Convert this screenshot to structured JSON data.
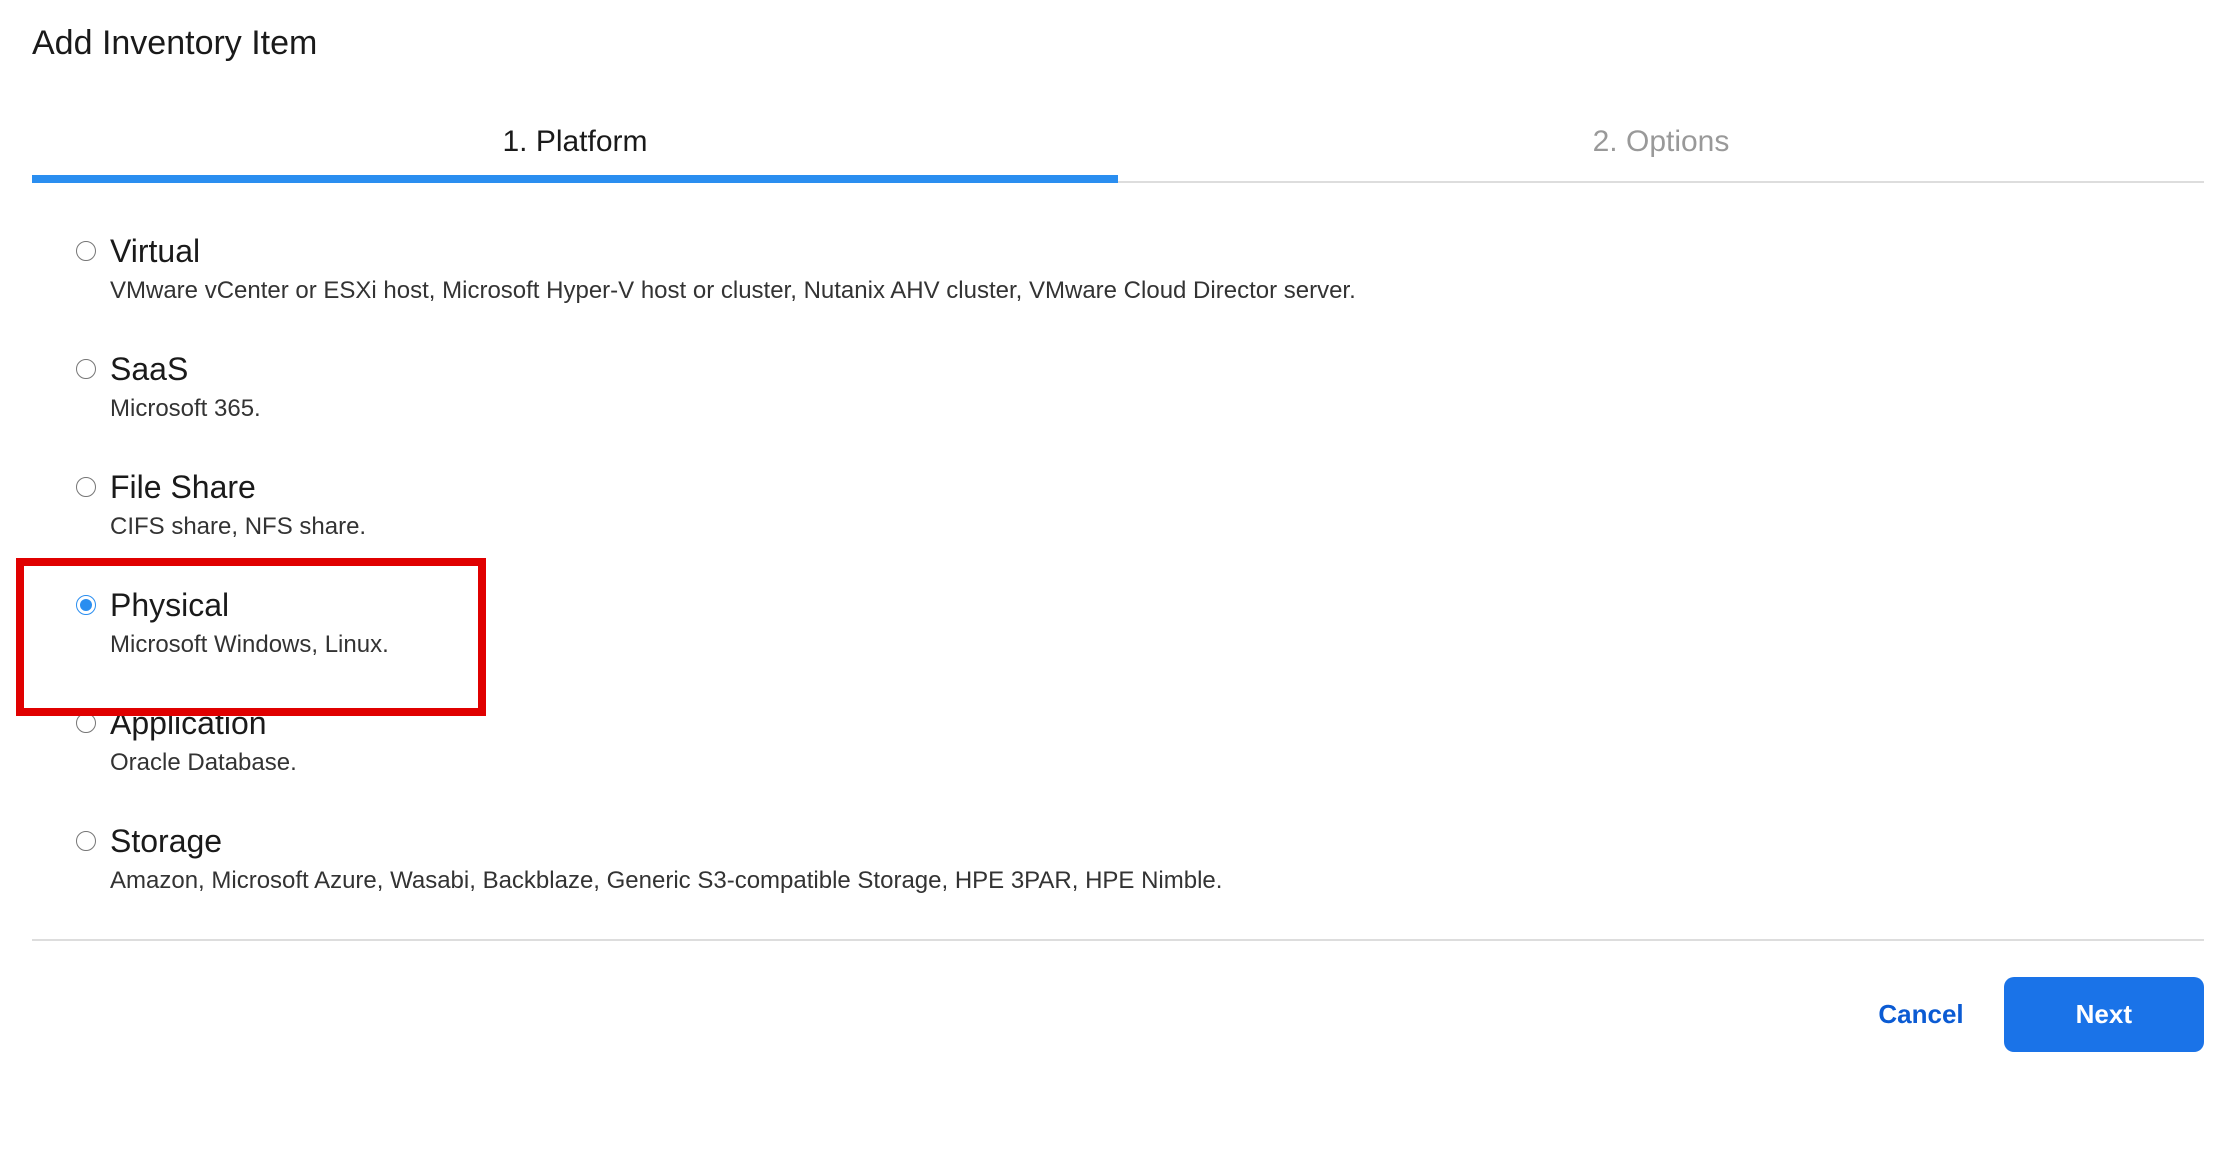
{
  "dialog": {
    "title": "Add Inventory Item"
  },
  "steps": {
    "platform": "1. Platform",
    "options": "2. Options"
  },
  "platformOptions": {
    "virtual": {
      "title": "Virtual",
      "desc": "VMware vCenter or ESXi host, Microsoft Hyper-V host or cluster, Nutanix AHV cluster, VMware Cloud Director server."
    },
    "saas": {
      "title": "SaaS",
      "desc": "Microsoft 365."
    },
    "fileShare": {
      "title": "File Share",
      "desc": "CIFS share, NFS share."
    },
    "physical": {
      "title": "Physical",
      "desc": "Microsoft Windows, Linux."
    },
    "application": {
      "title": "Application",
      "desc": "Oracle Database."
    },
    "storage": {
      "title": "Storage",
      "desc": "Amazon, Microsoft Azure, Wasabi, Backblaze, Generic S3-compatible Storage, HPE 3PAR, HPE Nimble."
    }
  },
  "selected": "physical",
  "footer": {
    "cancel": "Cancel",
    "next": "Next"
  }
}
